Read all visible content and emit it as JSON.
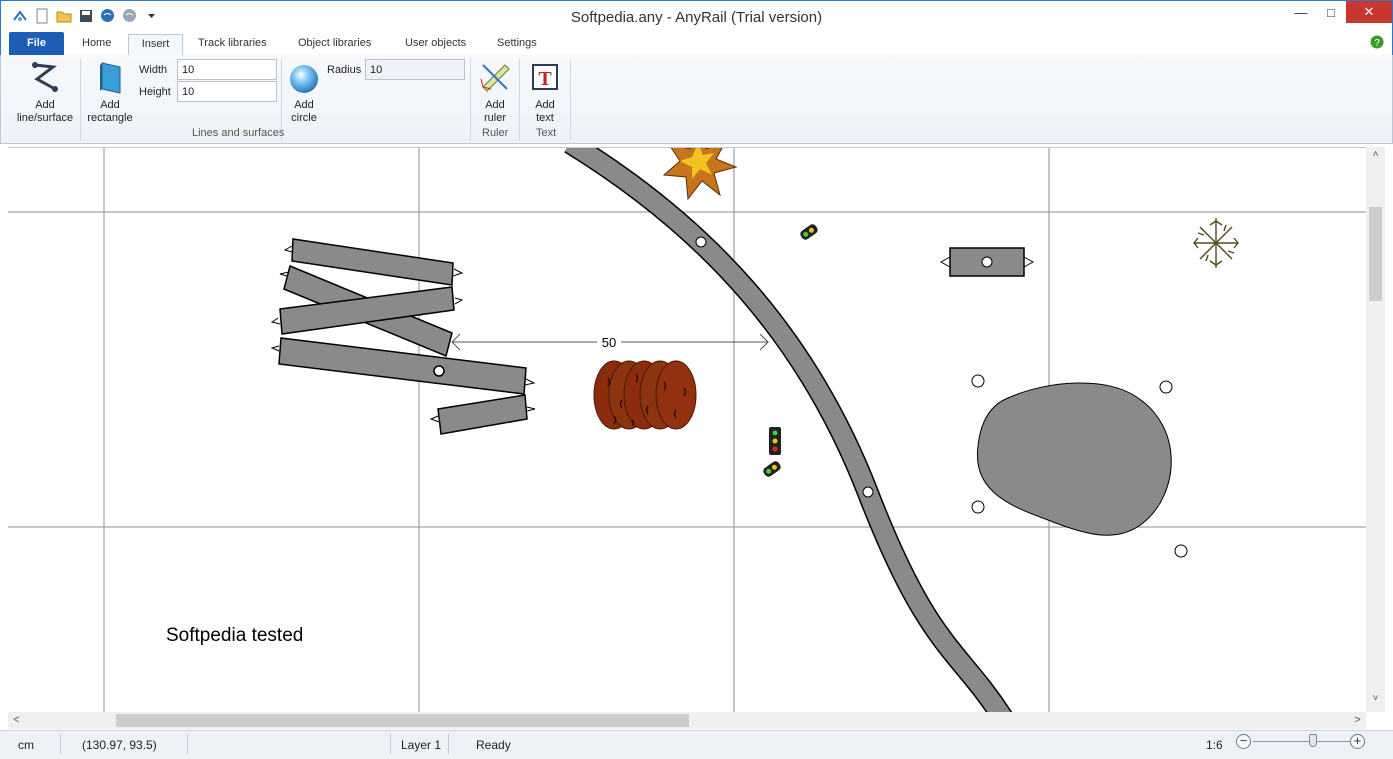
{
  "window": {
    "title": "Softpedia.any - AnyRail (Trial version)",
    "minimize": "—",
    "maximize": "□",
    "close": "✕"
  },
  "quick_access": [
    "app-icon",
    "new-file-icon",
    "open-folder-icon",
    "save-icon",
    "globe-icon",
    "globe-gray-icon",
    "dropdown-arrow-icon"
  ],
  "tabs": {
    "file": "File",
    "home": "Home",
    "insert": "Insert",
    "track_libraries": "Track libraries",
    "object_libraries": "Object libraries",
    "user_objects": "User objects",
    "settings": "Settings"
  },
  "ribbon": {
    "add_line_surface": [
      "Add",
      "line/surface"
    ],
    "add_rectangle": [
      "Add",
      "rectangle"
    ],
    "width_label": "Width",
    "width_value": "10",
    "height_label": "Height",
    "height_value": "10",
    "add_circle": [
      "Add",
      "circle"
    ],
    "radius_label": "Radius",
    "radius_value": "10",
    "group_lines_surfaces": "Lines and surfaces",
    "add_ruler": [
      "Add",
      "ruler"
    ],
    "group_ruler": "Ruler",
    "add_text": [
      "Add",
      "text"
    ],
    "group_text": "Text"
  },
  "canvas": {
    "ruler_value": "50",
    "text_label": "Softpedia tested"
  },
  "scroll": {
    "up": "˄",
    "down": "˅",
    "left": "<",
    "right": ">"
  },
  "status": {
    "unit": "cm",
    "coords": "(130.97, 93.5)",
    "layer": "Layer 1",
    "state": "Ready",
    "scale": "1:6",
    "zoom_level": 0.6
  },
  "colors": {
    "accent": "#1d5fb8",
    "track": "#8a8a8a",
    "close": "#c7372f"
  }
}
